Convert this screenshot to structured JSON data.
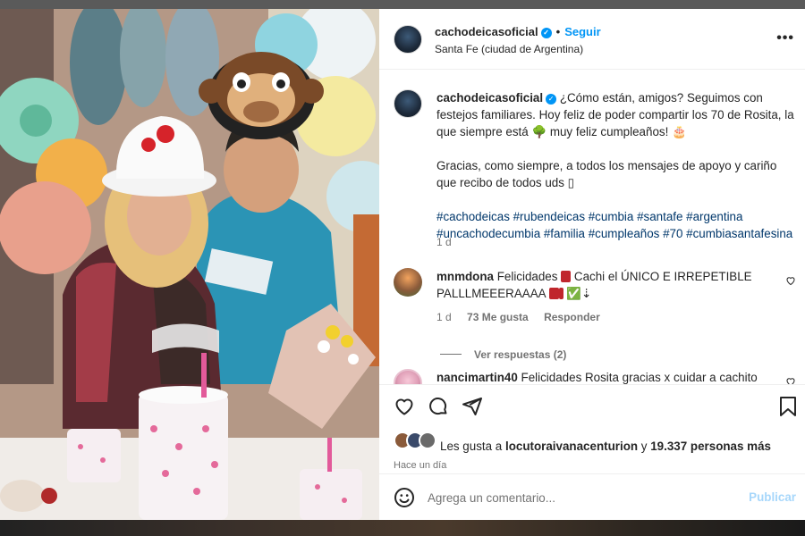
{
  "post": {
    "username": "cachodeicasoficial",
    "follow_label": "Seguir",
    "location": "Santa Fe (ciudad de Argentina)",
    "more_label": "•••"
  },
  "caption": {
    "username": "cachodeicasoficial",
    "text": "¿Cómo están, amigos? Seguimos con festejos familiares. Hoy feliz de poder compartir los 70 de Rosita, la que siempre está 🌳 muy feliz cumpleaños! 🎂",
    "text2": "Gracias, como siempre, a todos los mensajes de apoyo y cariño que recibo de todos uds ▯",
    "hashtags": "#cachodeicas #rubendeicas #cumbia #santafe #argentina #uncachodecumbia #familia #cumpleaños #70 #cumbiasantafesina",
    "time": "1 d"
  },
  "comments": [
    {
      "username": "mnmdona",
      "text_a": "Felicidades",
      "text_b": "Cachi el ÚNICO E IRREPETIBLE PALLLMEEERAAAA",
      "text_c": "✅",
      "text_d": "⇣",
      "time": "1 d",
      "likes": "73 Me gusta",
      "reply": "Responder",
      "view_replies": "Ver respuestas (2)"
    },
    {
      "username": "nancimartin40",
      "text": "Felicidades Rosita gracias x cuidar a cachito"
    }
  ],
  "likes": {
    "prefix": "Les gusta a",
    "user": "locutoraivanacenturion",
    "middle": "y",
    "count": "19.337 personas más"
  },
  "time_ago": "Hace un día",
  "add_comment": {
    "placeholder": "Agrega un comentario...",
    "publish_label": "Publicar"
  },
  "colors": {
    "link_blue": "#0095f6",
    "hashtag_blue": "#00376b",
    "muted": "#737373"
  },
  "icons": [
    "heart-icon",
    "comment-icon",
    "share-icon",
    "bookmark-icon",
    "emoji-icon",
    "verified-icon",
    "more-icon"
  ]
}
